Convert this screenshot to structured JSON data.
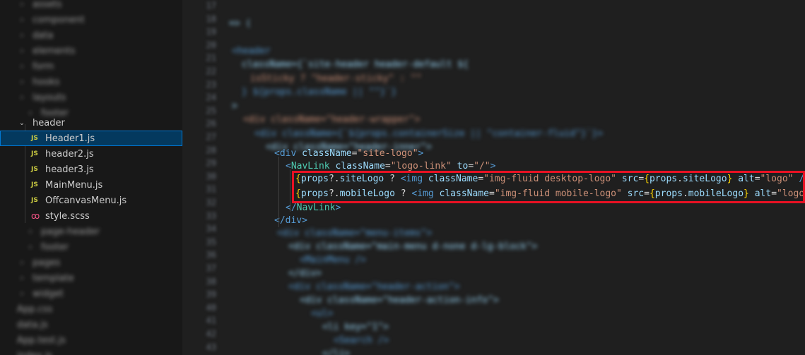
{
  "sidebar": {
    "blurred_top": [
      "assets",
      "component",
      "data",
      "elements",
      "form",
      "hooks",
      "layouts",
      "footer"
    ],
    "header_folder": "header",
    "files": [
      {
        "name": "Header1.js",
        "type": "js",
        "selected": true
      },
      {
        "name": "header2.js",
        "type": "js",
        "selected": false
      },
      {
        "name": "header3.js",
        "type": "js",
        "selected": false
      },
      {
        "name": "MainMenu.js",
        "type": "js",
        "selected": false
      },
      {
        "name": "OffcanvasMenu.js",
        "type": "js",
        "selected": false
      },
      {
        "name": "style.scss",
        "type": "scss",
        "selected": false
      }
    ],
    "blurred_bottom": [
      "page-header",
      "footer",
      "pages",
      "template",
      "widget",
      "App.css",
      "data.js",
      "App.test.js",
      "index.js"
    ]
  },
  "editor": {
    "clear_lines": [
      {
        "parts": [
          [
            "tag",
            "<div "
          ],
          [
            "attr",
            "className"
          ],
          [
            "plain",
            "="
          ],
          [
            "str",
            "\"site-logo\""
          ],
          [
            "tag",
            ">"
          ]
        ]
      },
      {
        "parts": [
          [
            "tag",
            "<"
          ],
          [
            "tagc",
            "NavLink "
          ],
          [
            "attr",
            "className"
          ],
          [
            "plain",
            "="
          ],
          [
            "str",
            "\"logo-link\" "
          ],
          [
            "attr",
            "to"
          ],
          [
            "plain",
            "="
          ],
          [
            "str",
            "\"/\""
          ],
          [
            "tag",
            ">"
          ]
        ]
      },
      {
        "parts": [
          [
            "brace",
            "{"
          ],
          [
            "var",
            "props"
          ],
          [
            "plain",
            "?."
          ],
          [
            "var",
            "siteLogo"
          ],
          [
            "plain",
            " ? "
          ],
          [
            "tag",
            "<img "
          ],
          [
            "attr",
            "className"
          ],
          [
            "plain",
            "="
          ],
          [
            "str",
            "\"img-fluid desktop-logo\" "
          ],
          [
            "attr",
            "src"
          ],
          [
            "plain",
            "="
          ],
          [
            "brace",
            "{"
          ],
          [
            "var",
            "props"
          ],
          [
            "plain",
            "."
          ],
          [
            "var",
            "siteLogo"
          ],
          [
            "brace",
            "}"
          ],
          [
            "plain",
            " "
          ],
          [
            "attr",
            "alt"
          ],
          [
            "plain",
            "="
          ],
          [
            "str",
            "\"logo\" "
          ],
          [
            "tag",
            "/>"
          ]
        ]
      },
      {
        "parts": [
          [
            "brace",
            "{"
          ],
          [
            "var",
            "props"
          ],
          [
            "plain",
            "?."
          ],
          [
            "var",
            "mobileLogo"
          ],
          [
            "plain",
            " ? "
          ],
          [
            "tag",
            "<img "
          ],
          [
            "attr",
            "className"
          ],
          [
            "plain",
            "="
          ],
          [
            "str",
            "\"img-fluid mobile-logo\" "
          ],
          [
            "attr",
            "src"
          ],
          [
            "plain",
            "="
          ],
          [
            "brace",
            "{"
          ],
          [
            "var",
            "props"
          ],
          [
            "plain",
            "."
          ],
          [
            "var",
            "mobileLogo"
          ],
          [
            "brace",
            "}"
          ],
          [
            "plain",
            " "
          ],
          [
            "attr",
            "alt"
          ],
          [
            "plain",
            "="
          ],
          [
            "str",
            "\"logo\""
          ]
        ]
      },
      {
        "parts": [
          [
            "tag",
            "</"
          ],
          [
            "tagc",
            "NavLink"
          ],
          [
            "tag",
            ">"
          ]
        ]
      },
      {
        "parts": [
          [
            "tag",
            "</div>"
          ]
        ]
      }
    ],
    "blurred_lines_top": [
      "18",
      "19 => (",
      "20",
      "21 <header",
      "22 className={`site-header header-default ${",
      "23 isSticky ? \"header-sticky\" : \"\"",
      "24 } ${props.className || \"\"}`}",
      "25 >",
      "26 <div className=\"header-wrapper\">",
      "27 <div className={`${props.containerSize || \"container-fluid\"}`}>",
      "28 <div className=\"header-inner\">"
    ],
    "blurred_lines_bottom": [
      "<div className=\"menu-items\">",
      "<div className=\"main-menu d-none d-lg-block\">",
      "<MainMenu />",
      "</div>",
      "<div className=\"header-action\">",
      "<div className=\"header-action-info\">",
      "<ul>",
      "<li key=\"1\">",
      "<Search />",
      "</li>"
    ],
    "line_numbers": [
      "17",
      "18",
      "19",
      "20",
      "21",
      "22",
      "23",
      "24",
      "25",
      "26",
      "27",
      "28",
      "29",
      "30",
      "31",
      "32",
      "33",
      "34",
      "35",
      "36",
      "37",
      "38",
      "39",
      "40",
      "41",
      "42",
      "43"
    ]
  }
}
